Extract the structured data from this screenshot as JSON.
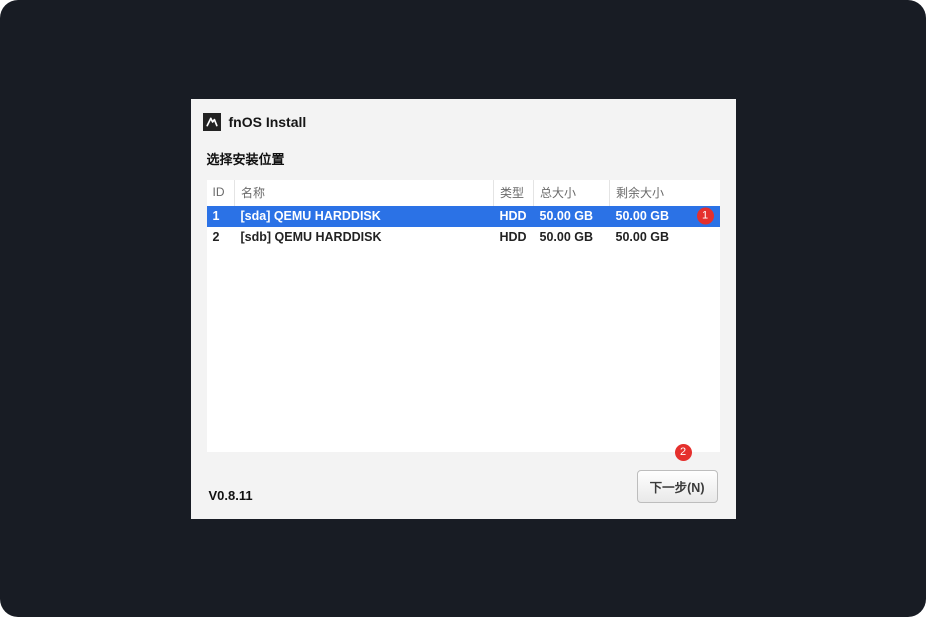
{
  "header": {
    "title": "fnOS Install"
  },
  "subtitle": "选择安装位置",
  "table": {
    "headers": {
      "id": "ID",
      "name": "名称",
      "type": "类型",
      "total": "总大小",
      "free": "剩余大小"
    },
    "rows": [
      {
        "id": "1",
        "name": "[sda] QEMU HARDDISK",
        "type": "HDD",
        "total": "50.00 GB",
        "free": "50.00 GB",
        "selected": true
      },
      {
        "id": "2",
        "name": "[sdb] QEMU HARDDISK",
        "type": "HDD",
        "total": "50.00 GB",
        "free": "50.00 GB",
        "selected": false
      }
    ]
  },
  "annotations": {
    "row_badge": "1",
    "button_badge": "2"
  },
  "footer": {
    "version": "V0.8.11",
    "next_button": "下一步(N)"
  }
}
